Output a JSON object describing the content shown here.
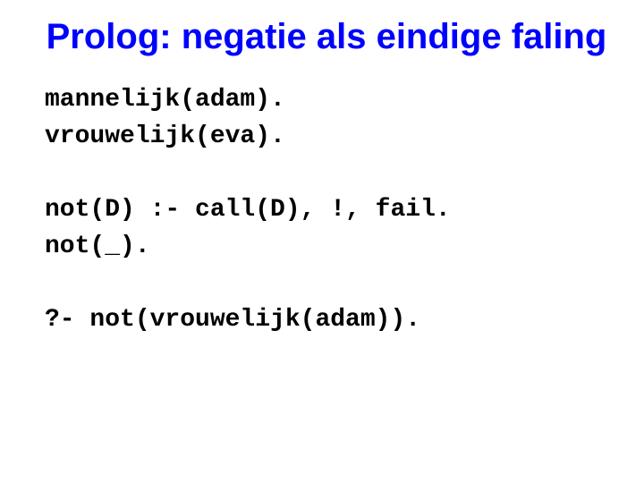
{
  "title": "Prolog: negatie als eindige faling",
  "code": {
    "facts": "mannelijk(adam).\nvrouwelijk(eva).",
    "rules": "not(D) :- call(D), !, fail.\nnot(_).",
    "query": "?- not(vrouwelijk(adam))."
  }
}
